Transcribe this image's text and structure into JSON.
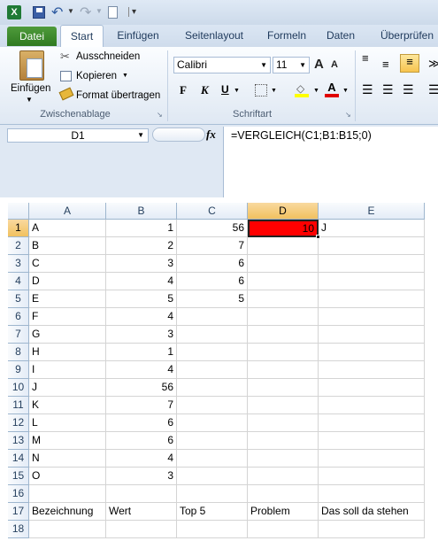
{
  "quick_access": {
    "app_icon": "excel-icon",
    "customize": "▾"
  },
  "tabs": [
    "Datei",
    "Start",
    "Einfügen",
    "Seitenlayout",
    "Formeln",
    "Daten",
    "Überprüfen"
  ],
  "ribbon": {
    "paste": "Einfügen",
    "cut": "Ausschneiden",
    "copy": "Kopieren",
    "format_painter": "Format übertragen",
    "group_clipboard": "Zwischenablage",
    "font_name": "Calibri",
    "font_size": "11",
    "group_font": "Schriftart",
    "bold": "F",
    "italic": "K",
    "underline": "U",
    "grow": "A",
    "shrink": "A"
  },
  "formula_bar": {
    "name_box": "D1",
    "fx": "fx",
    "formula": "=VERGLEICH(C1;B1:B15;0)"
  },
  "columns": [
    "A",
    "B",
    "C",
    "D",
    "E"
  ],
  "rows": [
    {
      "n": "1",
      "A": "A",
      "B": "1",
      "C": "56",
      "D": "10",
      "E": "J"
    },
    {
      "n": "2",
      "A": "B",
      "B": "2",
      "C": "7",
      "D": "",
      "E": ""
    },
    {
      "n": "3",
      "A": "C",
      "B": "3",
      "C": "6",
      "D": "",
      "E": ""
    },
    {
      "n": "4",
      "A": "D",
      "B": "4",
      "C": "6",
      "D": "",
      "E": ""
    },
    {
      "n": "5",
      "A": "E",
      "B": "5",
      "C": "5",
      "D": "",
      "E": ""
    },
    {
      "n": "6",
      "A": "F",
      "B": "4",
      "C": "",
      "D": "",
      "E": ""
    },
    {
      "n": "7",
      "A": "G",
      "B": "3",
      "C": "",
      "D": "",
      "E": ""
    },
    {
      "n": "8",
      "A": "H",
      "B": "1",
      "C": "",
      "D": "",
      "E": ""
    },
    {
      "n": "9",
      "A": "I",
      "B": "4",
      "C": "",
      "D": "",
      "E": ""
    },
    {
      "n": "10",
      "A": "J",
      "B": "56",
      "C": "",
      "D": "",
      "E": ""
    },
    {
      "n": "11",
      "A": "K",
      "B": "7",
      "C": "",
      "D": "",
      "E": ""
    },
    {
      "n": "12",
      "A": "L",
      "B": "6",
      "C": "",
      "D": "",
      "E": ""
    },
    {
      "n": "13",
      "A": "M",
      "B": "6",
      "C": "",
      "D": "",
      "E": ""
    },
    {
      "n": "14",
      "A": "N",
      "B": "4",
      "C": "",
      "D": "",
      "E": ""
    },
    {
      "n": "15",
      "A": "O",
      "B": "3",
      "C": "",
      "D": "",
      "E": ""
    },
    {
      "n": "16",
      "A": "",
      "B": "",
      "C": "",
      "D": "",
      "E": ""
    },
    {
      "n": "17",
      "A": "Bezeichnung",
      "B": "Wert",
      "C": "Top 5",
      "D": "Problem",
      "E": "Das soll da stehen"
    },
    {
      "n": "18",
      "A": "",
      "B": "",
      "C": "",
      "D": "",
      "E": ""
    }
  ],
  "selected_cell": "D1",
  "colors": {
    "selected_fill": "#ff0000",
    "ribbon": "#dfe8f3",
    "header_selected": "#f5c76a"
  }
}
